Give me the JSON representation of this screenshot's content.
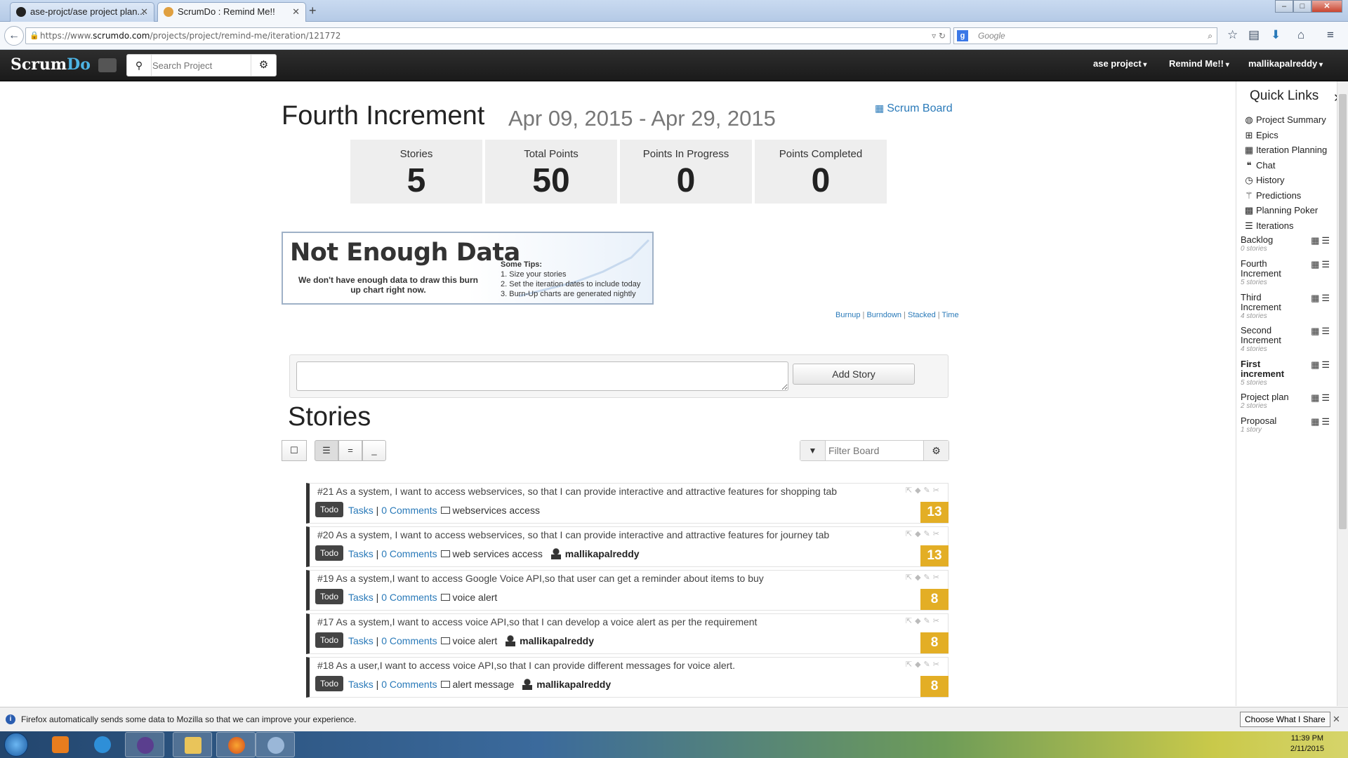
{
  "browser": {
    "tabs": [
      {
        "title": "ase-projct/ase project plan..."
      },
      {
        "title": "ScrumDo : Remind Me!!"
      }
    ],
    "url_prefix": "https://www.",
    "url_domain": "scrumdo.com",
    "url_path": "/projects/project/remind-me/iteration/121772",
    "search_placeholder": "Google"
  },
  "app": {
    "logo_a": "Scrum",
    "logo_b": "Do",
    "search_placeholder": "Search Project",
    "menus": [
      "ase project",
      "Remind Me!!",
      "mallikapalreddy"
    ]
  },
  "iteration": {
    "title": "Fourth Increment",
    "dates": "Apr 09, 2015 - Apr 29, 2015",
    "scrum_board_label": "Scrum Board"
  },
  "stats": [
    {
      "label": "Stories",
      "value": "5"
    },
    {
      "label": "Total Points",
      "value": "50"
    },
    {
      "label": "Points In Progress",
      "value": "0"
    },
    {
      "label": "Points Completed",
      "value": "0"
    }
  ],
  "chart_placeholder": {
    "heading": "Not Enough Data",
    "message": "We don't have enough data to draw this burn up chart right now.",
    "tips_title": "Some Tips:",
    "tips": [
      "1. Size your stories",
      "2. Set the iteration dates to include today",
      "3. Burn-Up charts are generated nightly"
    ]
  },
  "chart_links": [
    "Burnup",
    "Burndown",
    "Stacked",
    "Time"
  ],
  "add_story_label": "Add Story",
  "stories_heading": "Stories",
  "filter_placeholder": "Filter Board",
  "stories": [
    {
      "summary": "#21 As a system, I want to access webservices, so that I can provide interactive and attractive features for shopping tab",
      "status": "Todo",
      "tasks": "Tasks",
      "comments": "0 Comments",
      "epic": "webservices access",
      "owner": "",
      "points": "13"
    },
    {
      "summary": "#20 As a system, I want to access webservices, so that I can provide interactive and attractive features for journey tab",
      "status": "Todo",
      "tasks": "Tasks",
      "comments": "0 Comments",
      "epic": "web services access",
      "owner": "mallikapalreddy",
      "points": "13"
    },
    {
      "summary": "#19 As a system,I want to access Google Voice API,so that user can get a reminder about items to buy",
      "status": "Todo",
      "tasks": "Tasks",
      "comments": "0 Comments",
      "epic": "voice alert",
      "owner": "",
      "points": "8"
    },
    {
      "summary": "#17 As a system,I want to access voice API,so that I can develop a voice alert as per the requirement",
      "status": "Todo",
      "tasks": "Tasks",
      "comments": "0 Comments",
      "epic": "voice alert",
      "owner": "mallikapalreddy",
      "points": "8"
    },
    {
      "summary": "#18 As a user,I want to access voice API,so that I can provide different messages for voice alert.",
      "status": "Todo",
      "tasks": "Tasks",
      "comments": "0 Comments",
      "epic": "alert message",
      "owner": "mallikapalreddy",
      "points": "8"
    }
  ],
  "quick_links": {
    "title": "Quick Links",
    "links": [
      {
        "label": "Project Summary",
        "icon": "globe-icon"
      },
      {
        "label": "Epics",
        "icon": "sitemap-icon"
      },
      {
        "label": "Iteration Planning",
        "icon": "calendar-icon"
      },
      {
        "label": "Chat",
        "icon": "quote-icon"
      },
      {
        "label": "History",
        "icon": "clock-icon"
      },
      {
        "label": "Predictions",
        "icon": "wand-icon"
      },
      {
        "label": "Planning Poker",
        "icon": "grid-icon"
      },
      {
        "label": "Iterations",
        "icon": "list-icon"
      }
    ],
    "iterations": [
      {
        "name": "Backlog",
        "count": "0 stories"
      },
      {
        "name": "Fourth Increment",
        "count": "5 stories"
      },
      {
        "name": "Third Increment",
        "count": "4 stories"
      },
      {
        "name": "Second Increment",
        "count": "4 stories"
      },
      {
        "name": "First increment",
        "count": "5 stories"
      },
      {
        "name": "Project plan",
        "count": "2 stories"
      },
      {
        "name": "Proposal",
        "count": "1 story"
      }
    ]
  },
  "notification": {
    "message": "Firefox automatically sends some data to Mozilla so that we can improve your experience.",
    "button": "Choose What I Share"
  },
  "clock": {
    "time": "11:39 PM",
    "date": "2/11/2015"
  },
  "colors": {
    "accent": "#2a7ab9",
    "points_badge": "#e3ae25",
    "header": "#222222"
  }
}
